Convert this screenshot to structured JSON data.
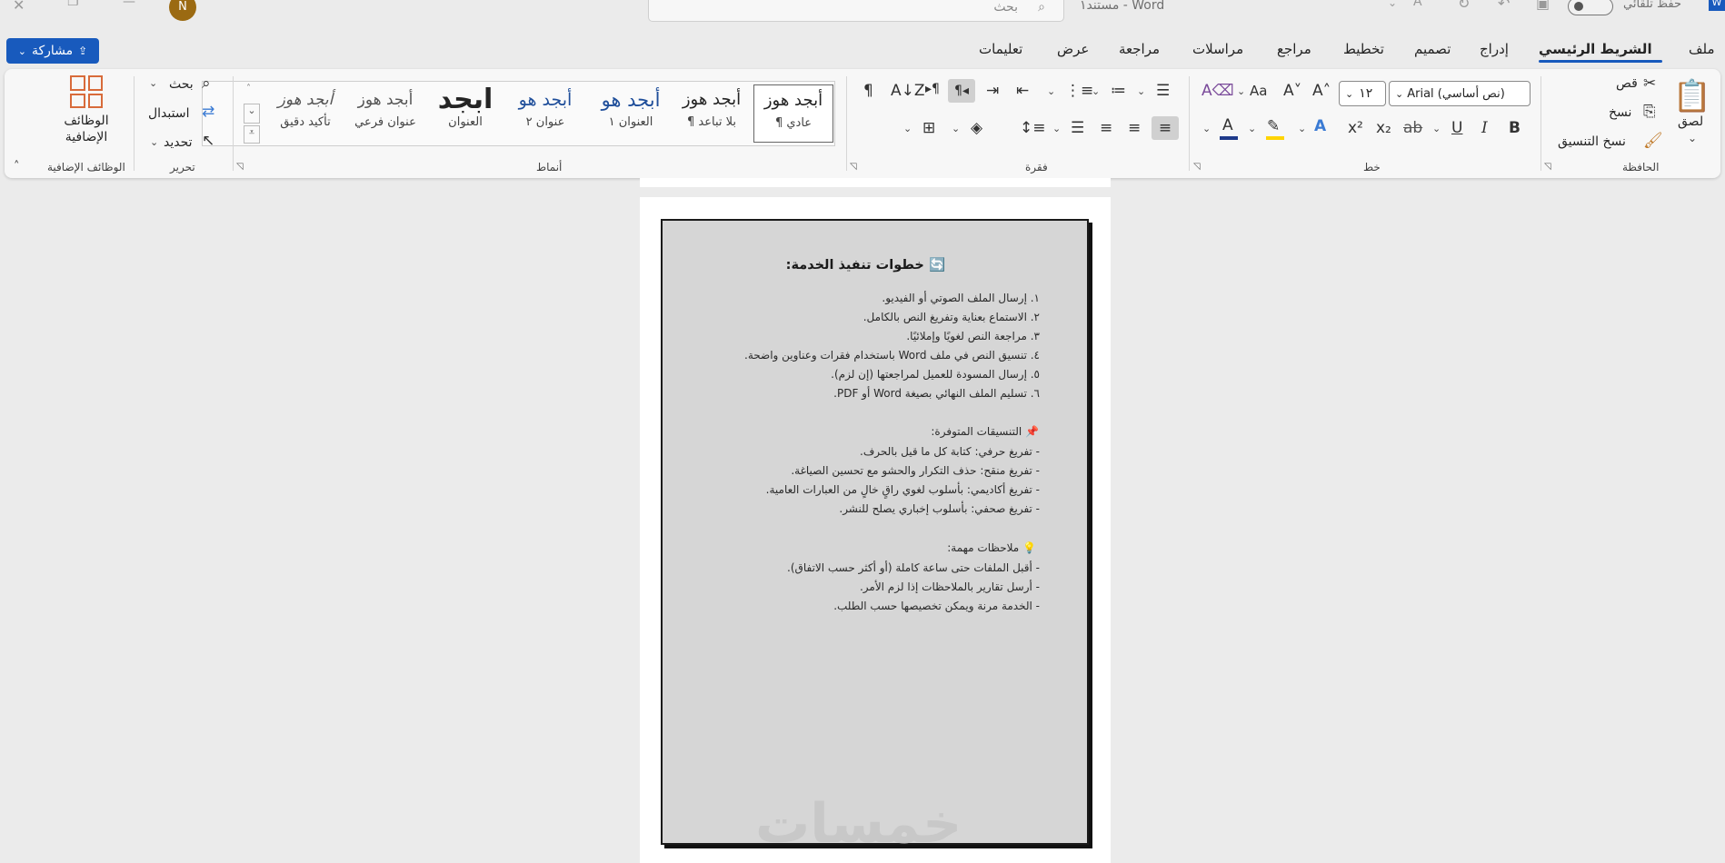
{
  "titlebar": {
    "doc_title": "مستند١  -  Word",
    "search_placeholder": "بحث",
    "autosave_label": "حفظ تلقائي",
    "avatar_initial": "N"
  },
  "tabs": [
    {
      "label": "ملف"
    },
    {
      "label": "الشريط الرئيسي",
      "active": true
    },
    {
      "label": "إدراج"
    },
    {
      "label": "تصميم"
    },
    {
      "label": "تخطيط"
    },
    {
      "label": "مراجع"
    },
    {
      "label": "مراسلات"
    },
    {
      "label": "مراجعة"
    },
    {
      "label": "عرض"
    },
    {
      "label": "تعليمات"
    }
  ],
  "share_label": "مشاركة",
  "clipboard": {
    "paste": "لصق",
    "cut": "قص",
    "copy": "نسخ",
    "format_painter": "نسخ التنسيق",
    "group_label": "الحافظة"
  },
  "font": {
    "family": "Arial (نص أساسي)",
    "size": "١٢",
    "group_label": "خط"
  },
  "paragraph": {
    "group_label": "فقرة"
  },
  "styles": {
    "group_label": "أنماط",
    "items": [
      {
        "preview": "أبجد هوز",
        "name": "¶ عادي"
      },
      {
        "preview": "أبجد هوز",
        "name": "¶ بلا تباعد"
      },
      {
        "preview": "أبجد هو",
        "name": "العنوان ١"
      },
      {
        "preview": "أبجد هو",
        "name": "عنوان ٢"
      },
      {
        "preview": "ابجد",
        "name": "العنوان"
      },
      {
        "preview": "أبجد هوز",
        "name": "عنوان فرعي"
      },
      {
        "preview": "أبجد هوز",
        "name": "تأكيد دقيق"
      }
    ]
  },
  "editing": {
    "find": "بحث",
    "replace": "استبدال",
    "select": "تحديد",
    "group_label": "تحرير"
  },
  "addins": {
    "button": "الوظائف الإضافية",
    "group_label": "الوظائف الإضافية"
  },
  "document": {
    "heading": "خطوات تنفيذ الخدمة:",
    "steps": [
      "١. إرسال الملف الصوتي أو الفيديو.",
      "٢. الاستماع بعناية وتفريغ النص بالكامل.",
      "٣. مراجعة النص لغويًا وإملائيًا.",
      "٤. تنسيق النص في ملف Word باستخدام فقرات وعناوين واضحة.",
      "٥. إرسال المسودة للعميل لمراجعتها (إن لزم).",
      "٦. تسليم الملف النهائي بصيغة Word أو PDF."
    ],
    "formats_heading": "التنسيقات المتوفرة:",
    "formats": [
      "- تفريغ حرفي: كتابة كل ما قيل بالحرف.",
      "- تفريغ منقح: حذف التكرار والحشو مع تحسين الصياغة.",
      "- تفريغ أكاديمي: بأسلوب لغوي راقٍ خالٍ من العبارات العامية.",
      "- تفريغ صحفي: بأسلوب إخباري يصلح للنشر."
    ],
    "notes_heading": "ملاحظات مهمة:",
    "notes": [
      "- أقبل الملفات حتى ساعة كاملة (أو أكثر حسب الاتفاق).",
      "- أرسل تقارير بالملاحظات إذا لزم الأمر.",
      "- الخدمة مرنة ويمكن تخصيصها حسب الطلب."
    ],
    "watermark": "خمسات"
  },
  "colors": {
    "accent": "#185abd",
    "highlight": "#ffd400",
    "font_color": "#1e3a8a"
  }
}
